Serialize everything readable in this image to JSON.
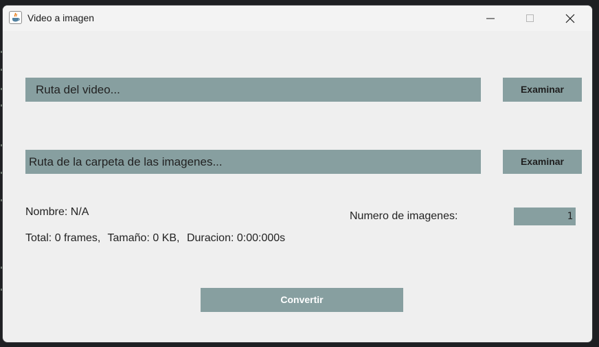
{
  "window": {
    "title": "Video a imagen",
    "icon": "java-cup-icon"
  },
  "controls": {
    "minimize_icon": "minimize-icon",
    "maximize_icon": "maximize-icon",
    "close_icon": "close-icon"
  },
  "video": {
    "placeholder": "Ruta del video...",
    "browse_label": "Examinar"
  },
  "folder": {
    "placeholder": "Ruta de la carpeta de las imagenes...",
    "browse_label": "Examinar"
  },
  "info": {
    "name": "Nombre: N/A",
    "total": "Total: 0 frames,",
    "size": "Tamaño: 0 KB,",
    "duration": "Duracion: 0:00:000s"
  },
  "count": {
    "label": "Numero de imagenes:",
    "value": "1"
  },
  "convert": {
    "label": "Convertir"
  },
  "colors": {
    "field_bg": "#879fa0",
    "window_bg": "#efefef"
  }
}
